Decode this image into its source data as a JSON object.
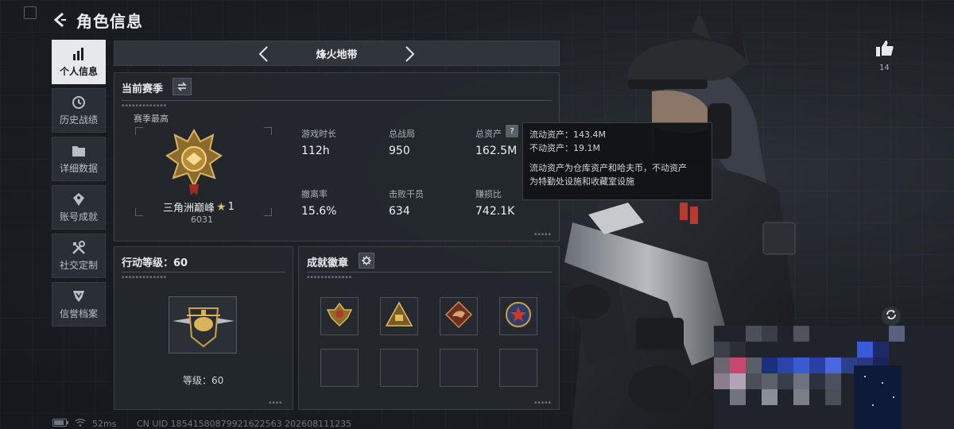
{
  "header": {
    "title": "角色信息"
  },
  "sidebar": {
    "items": [
      {
        "label": "个人信息",
        "icon": "bar-chart-icon",
        "active": true
      },
      {
        "label": "历史战绩",
        "icon": "history-icon",
        "active": false
      },
      {
        "label": "详细数据",
        "icon": "folder-icon",
        "active": false
      },
      {
        "label": "账号成就",
        "icon": "achievement-icon",
        "active": false
      },
      {
        "label": "社交定制",
        "icon": "tools-icon",
        "active": false
      },
      {
        "label": "信誉档案",
        "icon": "shield-icon",
        "active": false
      }
    ]
  },
  "season_selector": {
    "name": "烽火地带"
  },
  "current_season": {
    "title": "当前赛季",
    "best_label": "赛季最高",
    "rank_name": "三角洲巅峰",
    "rank_stars": "1",
    "rank_score": "6031",
    "stats": [
      {
        "label": "游戏时长",
        "value": "112h"
      },
      {
        "label": "总战局",
        "value": "950"
      },
      {
        "label": "总资产",
        "value": "162.5M"
      },
      {
        "label": "撤离率",
        "value": "15.6%"
      },
      {
        "label": "击败干员",
        "value": "634"
      },
      {
        "label": "赚损比",
        "value": "742.1K"
      }
    ]
  },
  "tooltip": {
    "liquid": "流动资产：143.4M",
    "fixed": "不动资产：19.1M",
    "desc_line1": "流动资产为仓库资产和哈夫币，不动资产",
    "desc_line2": "为特勤处设施和收藏室设施"
  },
  "action_level": {
    "title": "行动等级：60",
    "level_text": "等级：60"
  },
  "badges": {
    "title": "成就徽章",
    "slots": 8
  },
  "likes": {
    "count": "14"
  },
  "status": {
    "ping": "52ms",
    "uid": "CN UID 18541580879921622563 202608111235"
  },
  "colors": {
    "panel_bg": "#24282e",
    "accent_gold": "#c9a24a",
    "active_tab": "#e6e8ea"
  }
}
